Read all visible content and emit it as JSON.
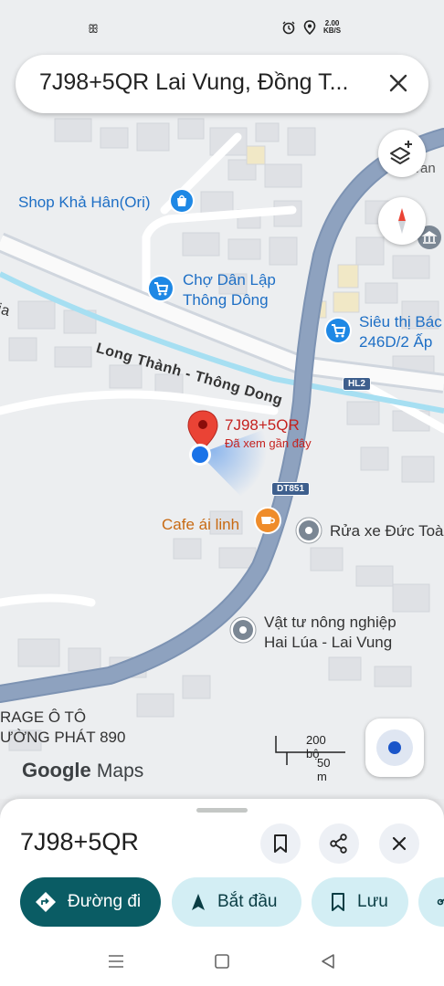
{
  "status": {
    "left_icon": "notification-glyph",
    "left_glyph": "ꕥ",
    "right_icons": [
      "alarm-icon",
      "location-icon"
    ],
    "net_speed_value": "2.00",
    "net_speed_unit": "KB/S"
  },
  "search": {
    "query": "7J98+5QR Lai Vung, Đồng T..."
  },
  "map": {
    "labels": {
      "shop": "Shop Khả Hân(Ori)",
      "cho_line1": "Chợ Dân Lập",
      "cho_line2": "Thông Dông",
      "sieuthi_line1": "Siêu thị Bác",
      "sieuthi_line2": "246D/2 Ấp",
      "street": "Long Thành - Thông Dong",
      "street_fragment": "ia",
      "partial_top_right": "ran",
      "pin_title": "7J98+5QR",
      "pin_sub": "Đã xem gần đây",
      "cafe": "Cafe ái linh",
      "ruaxe": "Rửa xe Đức Toà",
      "vattu_line1": "Vật tư nông nghiệp",
      "vattu_line2": "Hai Lúa - Lai Vung",
      "garage_line1": "RAGE Ô TÔ",
      "garage_line2": "ƯỜNG PHÁT 890"
    },
    "road_badges": {
      "hl2": "HL2",
      "dt851": "DT851"
    },
    "scale_ft": "200 bộ",
    "scale_m": "50 m",
    "logo_google": "Google",
    "logo_maps": "Maps"
  },
  "sheet": {
    "title": "7J98+5QR",
    "actions": {
      "directions": "Đường đi",
      "start": "Bắt đầu",
      "save": "Lưu"
    }
  },
  "colors": {
    "road_main": "#8ea2bf",
    "river": "#a6dff2",
    "primary_chip": "#0a5c64",
    "secondary_chip": "#d3eef4",
    "poi_blue": "#1e6fc5",
    "pin_red": "#ea4335",
    "location_blue": "#1a73e8"
  }
}
